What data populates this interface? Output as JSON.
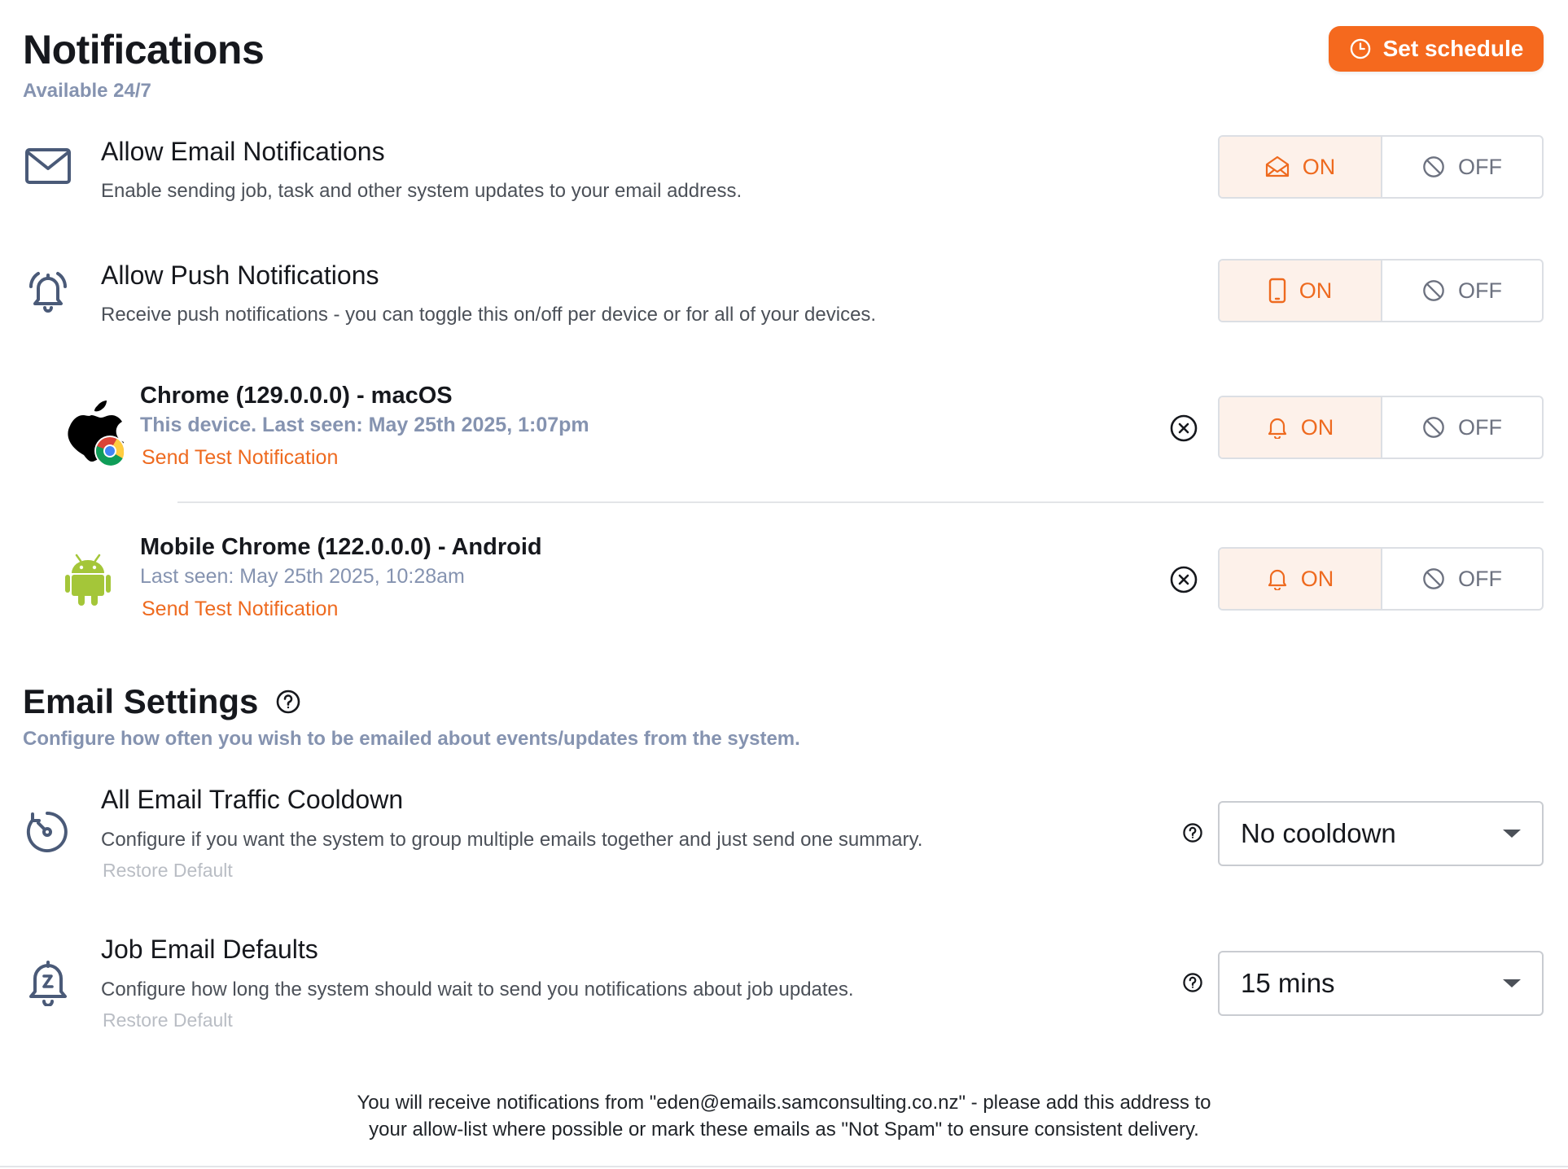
{
  "header": {
    "title": "Notifications",
    "subtitle": "Available 24/7",
    "schedule_label": "Set schedule"
  },
  "email_notifications": {
    "title": "Allow Email Notifications",
    "description": "Enable sending job, task and other system updates to your email address.",
    "on_label": "ON",
    "off_label": "OFF",
    "state": "on"
  },
  "push_notifications": {
    "title": "Allow Push Notifications",
    "description": "Receive push notifications - you can toggle this on/off per device or for all of your devices.",
    "on_label": "ON",
    "off_label": "OFF",
    "state": "on"
  },
  "devices": [
    {
      "name": "Chrome (129.0.0.0) - macOS",
      "status": "This device. Last seen: May 25th 2025, 1:07pm",
      "test_label": "Send Test Notification",
      "on_label": "ON",
      "off_label": "OFF",
      "state": "on",
      "icon": "apple-chrome-icon"
    },
    {
      "name": "Mobile Chrome (122.0.0.0) - Android",
      "status": "Last seen: May 25th 2025, 10:28am",
      "test_label": "Send Test Notification",
      "on_label": "ON",
      "off_label": "OFF",
      "state": "on",
      "icon": "android-icon"
    }
  ],
  "email_settings": {
    "title": "Email Settings",
    "subtitle": "Configure how often you wish to be emailed about events/updates from the system.",
    "items": [
      {
        "title": "All Email Traffic Cooldown",
        "description": "Configure if you want the system to group multiple emails together and just send one summary.",
        "restore_label": "Restore Default",
        "selected": "No cooldown",
        "icon": "cooldown-clock-icon"
      },
      {
        "title": "Job Email Defaults",
        "description": "Configure how long the system should wait to send you notifications about job updates.",
        "restore_label": "Restore Default",
        "selected": "15 mins",
        "icon": "bell-timer-icon"
      }
    ]
  },
  "footer": {
    "line1": "You will receive notifications from \"eden@emails.samconsulting.co.nz\" - please add this address to",
    "line2": "your allow-list where possible or mark these emails as \"Not Spam\" to ensure consistent delivery."
  },
  "colors": {
    "accent": "#ee6a1f",
    "button": "#f5691e",
    "muted_blue": "#8593b0",
    "on_bg": "#fdf1ea"
  }
}
